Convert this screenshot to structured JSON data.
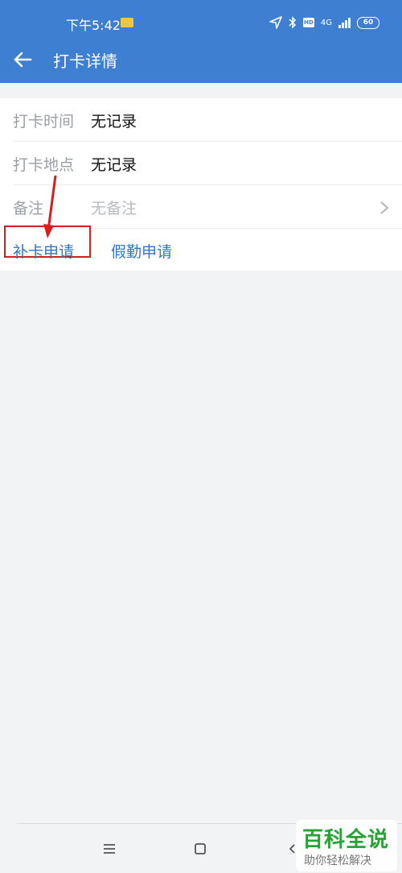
{
  "status_bar": {
    "time": "下午5:42",
    "sim_badge": "SIM",
    "hd_badge": "HD",
    "network": "4G",
    "battery": "60"
  },
  "header": {
    "title": "打卡详情",
    "back_icon": "arrow-left-icon"
  },
  "details": {
    "rows": [
      {
        "label": "打卡时间",
        "value": "无记录"
      },
      {
        "label": "打卡地点",
        "value": "无记录"
      },
      {
        "label": "备注",
        "value": "无备注"
      }
    ]
  },
  "actions": {
    "makeup_label": "补卡申请",
    "leave_label": "假勤申请"
  },
  "annotation": {
    "color": "#d71d1d"
  },
  "watermark": {
    "title": "百科全说",
    "subtitle": "助你轻松解决"
  },
  "colors": {
    "header_bg": "#3f7fd1",
    "link": "#2e78c7",
    "watermark_green": "#27a235"
  }
}
